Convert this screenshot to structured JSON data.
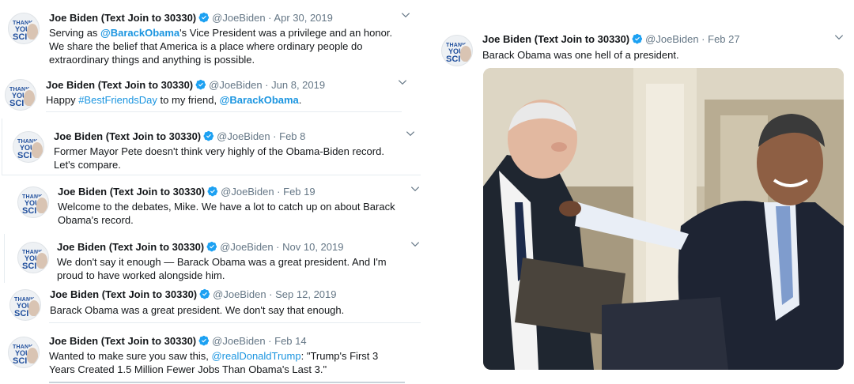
{
  "tweets": [
    {
      "avatar_label": {
        "l1": "THANK",
        "l2": "YOU",
        "l3": "SCI"
      },
      "name": "Joe Biden (Text Join to 30330)",
      "handle": "@JoeBiden",
      "date": "Apr 30, 2019",
      "parts": [
        {
          "t": "Serving as "
        },
        {
          "t": "@BarackObama",
          "s": "mention-bold"
        },
        {
          "t": "'s Vice President was a privilege and an honor."
        }
      ],
      "line2": "We share the belief that America is a place where ordinary people do",
      "line3": "extraordinary things and anything is possible."
    },
    {
      "avatar_label": {
        "l1": "THANK",
        "l2": "YOU",
        "l3": "SCI"
      },
      "name": "Joe Biden (Text Join to 30330)",
      "handle": "@JoeBiden",
      "date": "Jun 8, 2019",
      "parts": [
        {
          "t": "Happy "
        },
        {
          "t": "#BestFriendsDay",
          "s": "link"
        },
        {
          "t": " to my friend, "
        },
        {
          "t": "@BarackObama",
          "s": "mention-bold"
        },
        {
          "t": "."
        }
      ]
    },
    {
      "avatar_label": {
        "l1": "THANK",
        "l2": "YOU",
        "l3": "SCI"
      },
      "name": "Joe Biden (Text Join to 30330)",
      "handle": "@JoeBiden",
      "date": "Feb 8",
      "parts": [
        {
          "t": "Former Mayor Pete doesn't think very highly of the "
        },
        {
          "t": "Obama",
          "s": "hl"
        },
        {
          "t": "-Biden record."
        }
      ],
      "line2": "Let's compare."
    },
    {
      "avatar_label": {
        "l1": "THANK",
        "l2": "YOU",
        "l3": "SCI"
      },
      "name": "Joe Biden (Text Join to 30330)",
      "handle": "@JoeBiden",
      "date": "Feb 19",
      "parts": [
        {
          "t": "Welcome to the debates, Mike. We have a lot to catch up on about Barack"
        }
      ],
      "parts2": [
        {
          "t": "Obama",
          "s": "hl"
        },
        {
          "t": "'s record."
        }
      ]
    },
    {
      "avatar_label": {
        "l1": "THANK",
        "l2": "YOU",
        "l3": "SCI"
      },
      "name": "Joe Biden (Text Join to 30330)",
      "handle": "@JoeBiden",
      "date": "Nov 10, 2019",
      "parts": [
        {
          "t": "We don't say it enough — Barack "
        },
        {
          "t": "Obama",
          "s": "hl"
        },
        {
          "t": " was a great president. And I'm"
        }
      ],
      "line2": "proud to have worked alongside him."
    },
    {
      "avatar_label": {
        "l1": "THANK",
        "l2": "YOU",
        "l3": "SCI"
      },
      "name": "Joe Biden (Text Join to 30330)",
      "handle": "@JoeBiden",
      "date": "Sep 12, 2019",
      "parts": [
        {
          "t": "Barack "
        },
        {
          "t": "Obama",
          "s": "hl"
        },
        {
          "t": " was a great president. We don't say that enough."
        }
      ]
    },
    {
      "avatar_label": {
        "l1": "THANK",
        "l2": "YOU",
        "l3": "SCI"
      },
      "name": "Joe Biden (Text Join to 30330)",
      "handle": "@JoeBiden",
      "date": "Feb 14",
      "parts": [
        {
          "t": "Wanted to make sure you saw this, "
        },
        {
          "t": "@realDonaldTrump",
          "s": "link"
        },
        {
          "t": ": \"Trump's First 3"
        }
      ],
      "parts2": [
        {
          "t": "Years Created 1.5 Million Fewer Jobs Than "
        },
        {
          "t": "Obama",
          "s": "hl"
        },
        {
          "t": "'s Last 3.\""
        }
      ]
    },
    {
      "avatar_label": {
        "l1": "THANK",
        "l2": "YOU",
        "l3": "SCI"
      },
      "name": "Joe Biden (Text Join to 30330)",
      "handle": "@JoeBiden",
      "date": "Feb 27",
      "parts": [
        {
          "t": "Barack "
        },
        {
          "t": "Obama",
          "s": "hl"
        },
        {
          "t": " was one hell of a president."
        }
      ]
    }
  ],
  "dot": "·",
  "colors": {
    "link": "#1b95e0",
    "verified": "#1da1f2",
    "muted": "#657786"
  }
}
